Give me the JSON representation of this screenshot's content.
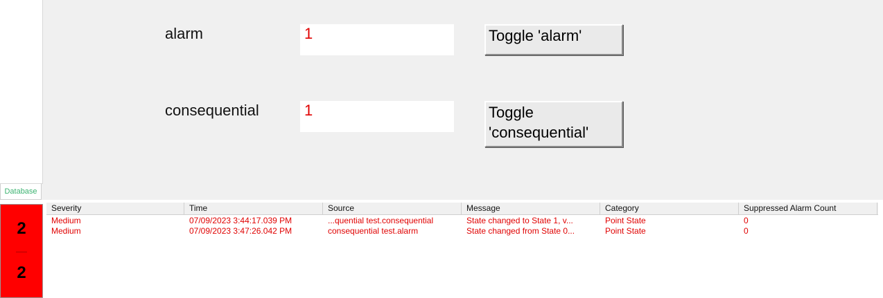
{
  "left_panel": {
    "tab_label": "Database"
  },
  "points": [
    {
      "label": "alarm",
      "value": "1",
      "button": "Toggle 'alarm'"
    },
    {
      "label": "consequential",
      "value": "1",
      "button_line1": "Toggle",
      "button_line2": "'consequential'"
    }
  ],
  "alarm_counter": {
    "top": "2",
    "bottom": "2",
    "color": "#ff0000"
  },
  "alarm_table": {
    "columns": [
      "Severity",
      "Time",
      "Source",
      "Message",
      "Category",
      "Suppressed Alarm Count"
    ],
    "rows": [
      [
        "Medium",
        "07/09/2023 3:44:17.039 PM",
        "...quential test.consequential",
        "State changed to State 1, v...",
        "Point State",
        "0"
      ],
      [
        "Medium",
        "07/09/2023 3:47:26.042 PM",
        "consequential test.alarm",
        "State changed from State 0...",
        "Point State",
        "0"
      ]
    ],
    "row_color": "#e00000"
  }
}
